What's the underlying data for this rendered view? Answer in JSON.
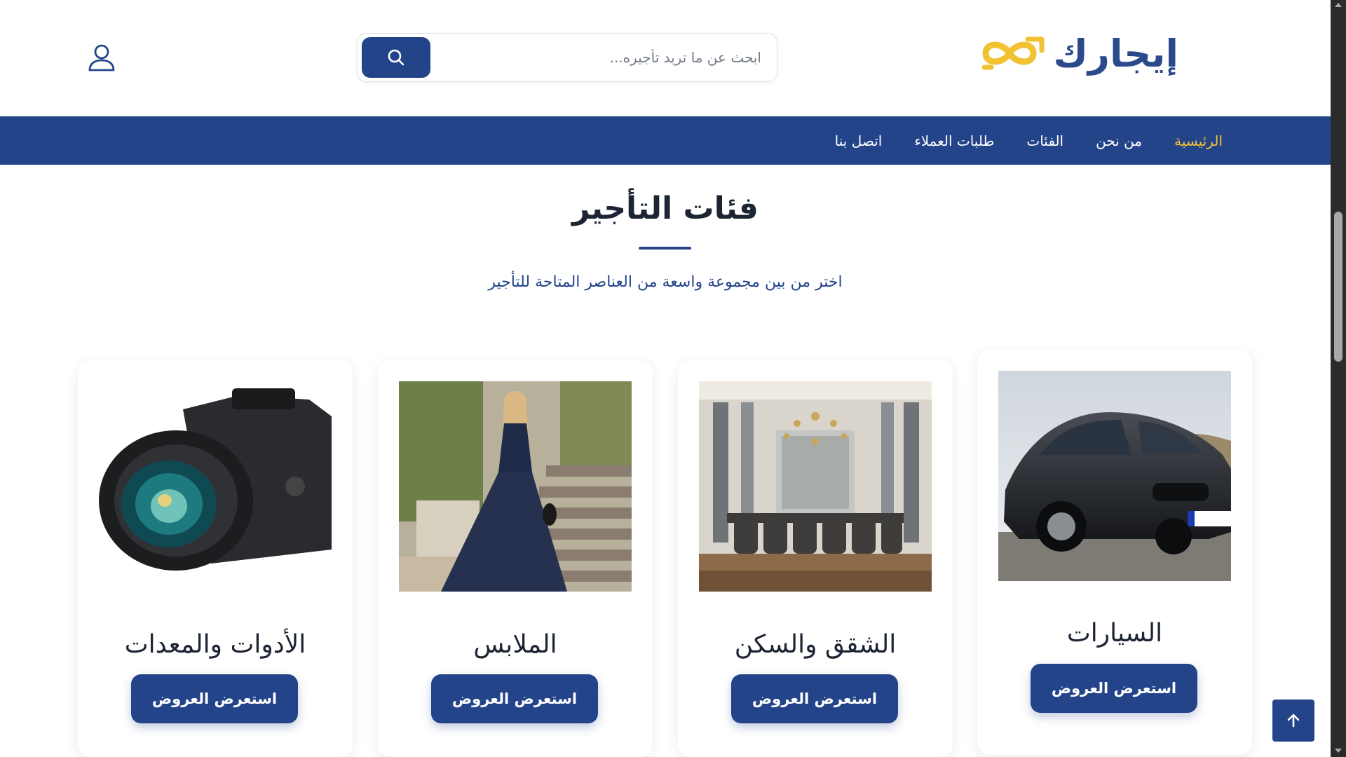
{
  "brand": {
    "name": "إيجارك",
    "logo_color": "#f1c232",
    "primary": "#24448a"
  },
  "search": {
    "placeholder": "ابحث عن ما تريد تأجيره...",
    "icon": "search-icon"
  },
  "header": {
    "user_icon": "user-icon"
  },
  "nav": {
    "items": [
      {
        "label": "الرئيسية",
        "active": true
      },
      {
        "label": "من نحن"
      },
      {
        "label": "الفئات"
      },
      {
        "label": "طلبات العملاء"
      },
      {
        "label": "اتصل بنا"
      }
    ]
  },
  "section": {
    "title": "فئات التأجير",
    "subtitle": "اختر من بين مجموعة واسعة من العناصر المتاحة للتأجير"
  },
  "categories": [
    {
      "title": "السيارات",
      "button": "استعرض العروض",
      "image": "car-image"
    },
    {
      "title": "الشقق والسكن",
      "button": "استعرض العروض",
      "image": "dining-room-image"
    },
    {
      "title": "الملابس",
      "button": "استعرض العروض",
      "image": "evening-dress-image"
    },
    {
      "title": "الأدوات والمعدات",
      "button": "استعرض العروض",
      "image": "camera-image"
    }
  ],
  "scroll_top": {
    "icon": "arrow-up-icon"
  }
}
